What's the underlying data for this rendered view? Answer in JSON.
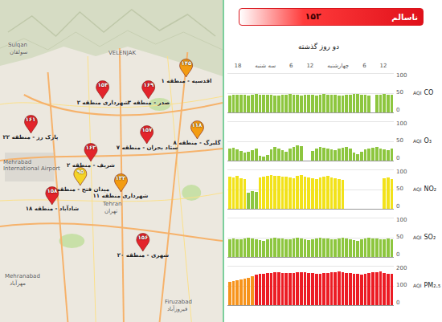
{
  "map": {
    "places": [
      "Sulqan",
      "سولقان",
      "VELENJAK",
      "Tehran",
      "تهران",
      "Mehrabad",
      "International Airport",
      "Mehranabad",
      "مهرآباد",
      "Firuzabad",
      "فیروزآباد"
    ],
    "pins": [
      {
        "value": "۱۴۵",
        "label": "اقدسیه - منطقه ۱",
        "color": "#f39c12"
      },
      {
        "value": "۱۵۴",
        "label": "شهرداری منطقه ۲",
        "color": "#e3242b"
      },
      {
        "value": "۱۶۹",
        "label": "صدر - منطقه ۳",
        "color": "#e3242b"
      },
      {
        "value": "۱۶۱",
        "label": "پارک رز - منطقه ۲۲",
        "color": "#e3242b"
      },
      {
        "value": "۱۵۷",
        "label": "ستاد بحران - منطقه ۷",
        "color": "#e3242b"
      },
      {
        "value": "۱۱۸",
        "label": "گلبرگ - منطقه ۸",
        "color": "#f39c12"
      },
      {
        "value": "۱۶۲",
        "label": "شریف - منطقه ۲",
        "color": "#e3242b"
      },
      {
        "value": "۹۵",
        "label": "میدان فتح - منطقه ۹",
        "color": "#f5d327"
      },
      {
        "value": "۱۳۲",
        "label": "شهرداری منطقه ۱۱",
        "color": "#f39c12"
      },
      {
        "value": "۱۵۸",
        "label": "شادآباد - منطقه ۱۸",
        "color": "#e3242b"
      },
      {
        "value": "۱۵۶",
        "label": "شهری - منطقه ۲۰",
        "color": "#e3242b"
      }
    ]
  },
  "status": {
    "label": "ناسالم",
    "value": "۱۵۲"
  },
  "history": {
    "title": "دو روز گذشته",
    "ticks": [
      "18",
      "سه شنبه",
      "6",
      "12",
      "چهارشنبه",
      "6",
      "12"
    ],
    "charts": [
      {
        "unit": "AQI",
        "name": "CO",
        "axis": [
          "100",
          "50",
          "0"
        ],
        "values": [
          42,
          44,
          45,
          45,
          44,
          43,
          44,
          46,
          45,
          44,
          45,
          44,
          43,
          42,
          44,
          45,
          46,
          45,
          44,
          43,
          44,
          45,
          44,
          43,
          45,
          46,
          44,
          45,
          44,
          43,
          42,
          44,
          45,
          46,
          47,
          45,
          44,
          43,
          0,
          44,
          45,
          46,
          45,
          44
        ]
      },
      {
        "unit": "AQI",
        "name": "O₃",
        "axis": [
          "100",
          "50",
          "0"
        ],
        "values": [
          30,
          32,
          28,
          25,
          20,
          22,
          26,
          30,
          12,
          10,
          14,
          28,
          34,
          30,
          26,
          22,
          30,
          35,
          38,
          36,
          0,
          0,
          24,
          30,
          34,
          32,
          30,
          28,
          26,
          30,
          32,
          34,
          30,
          20,
          16,
          22,
          28,
          30,
          32,
          34,
          30,
          28,
          26,
          30
        ]
      },
      {
        "unit": "AQI",
        "name": "NO₂",
        "axis": [
          "100",
          "50",
          "0"
        ],
        "values": [
          82,
          80,
          84,
          78,
          76,
          40,
          44,
          42,
          80,
          82,
          84,
          86,
          85,
          84,
          83,
          82,
          80,
          78,
          84,
          86,
          82,
          80,
          78,
          76,
          80,
          82,
          84,
          80,
          78,
          76,
          74,
          0,
          0,
          0,
          0,
          0,
          0,
          0,
          0,
          0,
          0,
          78,
          80,
          76
        ]
      },
      {
        "unit": "AQI",
        "name": "SO₂",
        "axis": [
          "100",
          "50",
          "0"
        ],
        "values": [
          44,
          46,
          45,
          44,
          46,
          48,
          47,
          44,
          42,
          40,
          44,
          46,
          48,
          47,
          46,
          45,
          44,
          46,
          48,
          46,
          44,
          42,
          44,
          46,
          48,
          47,
          46,
          45,
          44,
          46,
          48,
          46,
          44,
          42,
          40,
          44,
          46,
          48,
          47,
          46,
          45,
          44,
          46,
          45
        ]
      },
      {
        "unit": "AQI",
        "name": "PM₂.₅",
        "axis": [
          "200",
          "100",
          "0"
        ],
        "values": [
          118,
          122,
          126,
          130,
          136,
          140,
          150,
          156,
          160,
          162,
          164,
          166,
          168,
          168,
          166,
          164,
          165,
          166,
          168,
          170,
          168,
          166,
          164,
          162,
          160,
          164,
          166,
          168,
          170,
          172,
          168,
          166,
          164,
          162,
          160,
          158,
          162,
          166,
          168,
          170,
          172,
          166,
          162,
          160
        ]
      }
    ]
  }
}
